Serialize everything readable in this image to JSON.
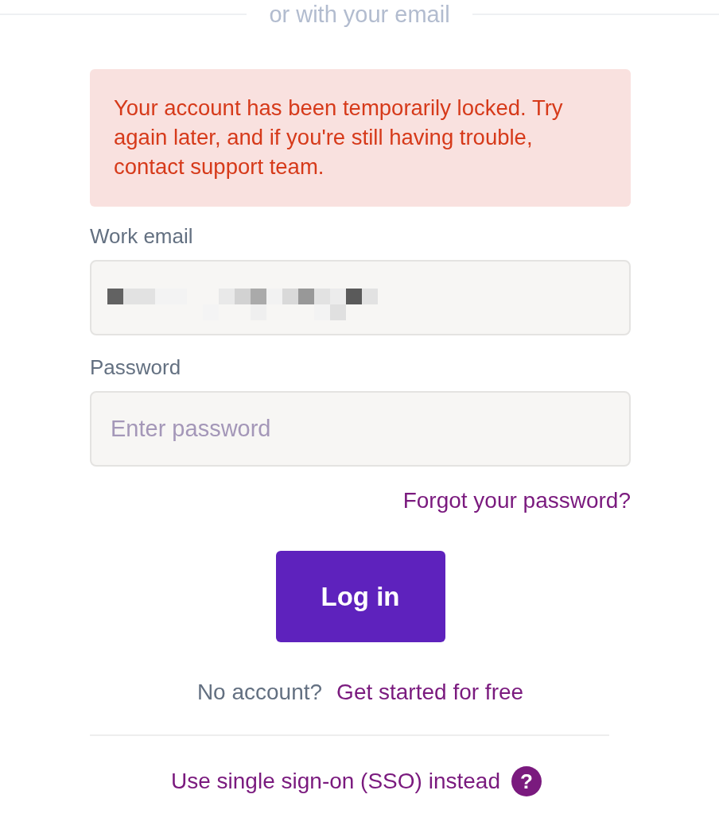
{
  "divider": {
    "label": "or with your email"
  },
  "alert": {
    "message": "Your account has been temporarily locked. Try again later, and if you're still having trouble, contact support team."
  },
  "fields": [
    {
      "label": "Work email",
      "value_redacted": true
    },
    {
      "label": "Password",
      "placeholder": "Enter password"
    }
  ],
  "forgot_link": "Forgot your password?",
  "login_button": "Log in",
  "signup": {
    "prompt": "No account?",
    "link": "Get started for free"
  },
  "sso_link": "Use single sign-on (SSO) instead",
  "help_icon": "?"
}
